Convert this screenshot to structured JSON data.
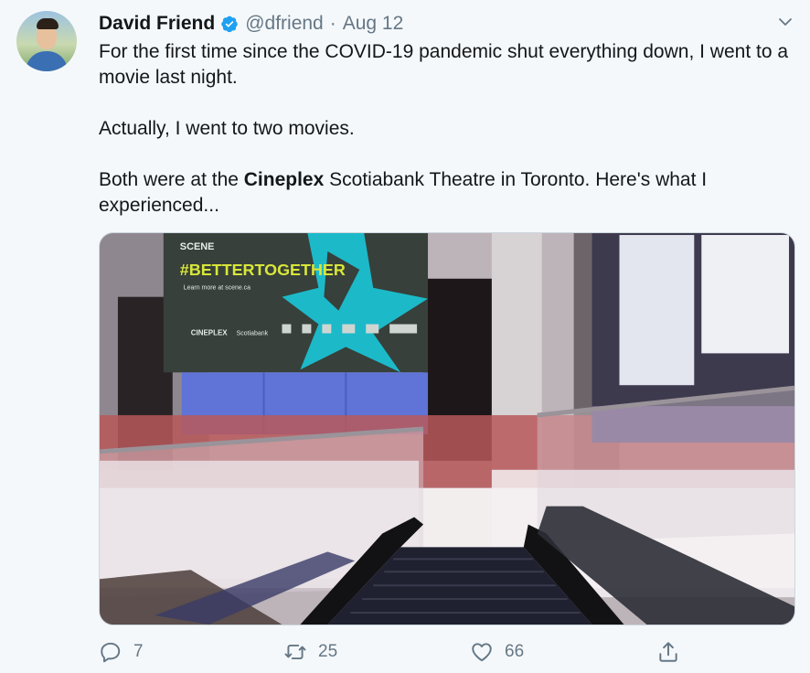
{
  "tweet": {
    "author_name": "David Friend",
    "handle": "@dfriend",
    "separator": "·",
    "date": "Aug 12",
    "paragraph_1": "For the first time since the COVID-19 pandemic shut everything down, I went to a movie last night.",
    "paragraph_2": "Actually, I went to two movies.",
    "paragraph_3_before": "Both were at the ",
    "paragraph_3_bold": "Cineplex",
    "paragraph_3_after": " Scotiabank Theatre in Toronto. Here's what I experienced...",
    "media_screen": {
      "brand": "SCENE",
      "hashtag": "#BETTERTOGETHER",
      "subline": "Learn more at scene.ca",
      "logo_1": "CINEPLEX",
      "logo_2": "Scotiabank"
    }
  },
  "actions": {
    "reply_count": "7",
    "retweet_count": "25",
    "like_count": "66"
  },
  "colors": {
    "background": "#f5f8fa",
    "verified_blue": "#1da1f2",
    "secondary_text": "#657786",
    "neon_cyan": "#19c6d9",
    "screen_yellow": "#d8e63a"
  },
  "icons": [
    "verified-badge-icon",
    "chevron-down-icon",
    "reply-icon",
    "retweet-icon",
    "like-icon",
    "share-icon"
  ]
}
